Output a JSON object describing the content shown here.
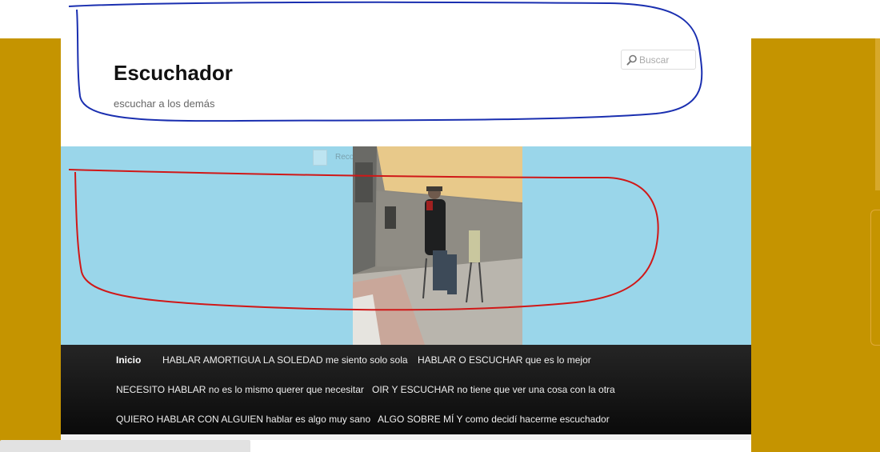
{
  "site": {
    "title": "Escuchador",
    "tagline": "escuchar a los demás"
  },
  "search": {
    "placeholder": "Buscar",
    "icon": "search-icon"
  },
  "banner": {
    "background": "#9ad6ea",
    "photo_overlay_text": "Recomendar"
  },
  "nav": {
    "items": [
      {
        "label": "Inicio",
        "active": true
      },
      {
        "label": "HABLAR AMORTIGUA LA SOLEDAD me siento solo sola"
      },
      {
        "label": "HABLAR O ESCUCHAR que es lo mejor"
      },
      {
        "label": "NECESITO HABLAR no es lo mismo querer que necesitar"
      },
      {
        "label": "OIR Y ESCUCHAR no tiene que ver una cosa con la otra"
      },
      {
        "label": "QUIERO HABLAR CON ALGUIEN hablar es algo muy sano"
      },
      {
        "label": "ALGO SOBRE MÍ Y como decidí hacerme escuchador"
      }
    ]
  },
  "colors": {
    "side_background": "#c59400",
    "annotation_blue": "#1a2fb0",
    "annotation_red": "#d01818"
  }
}
